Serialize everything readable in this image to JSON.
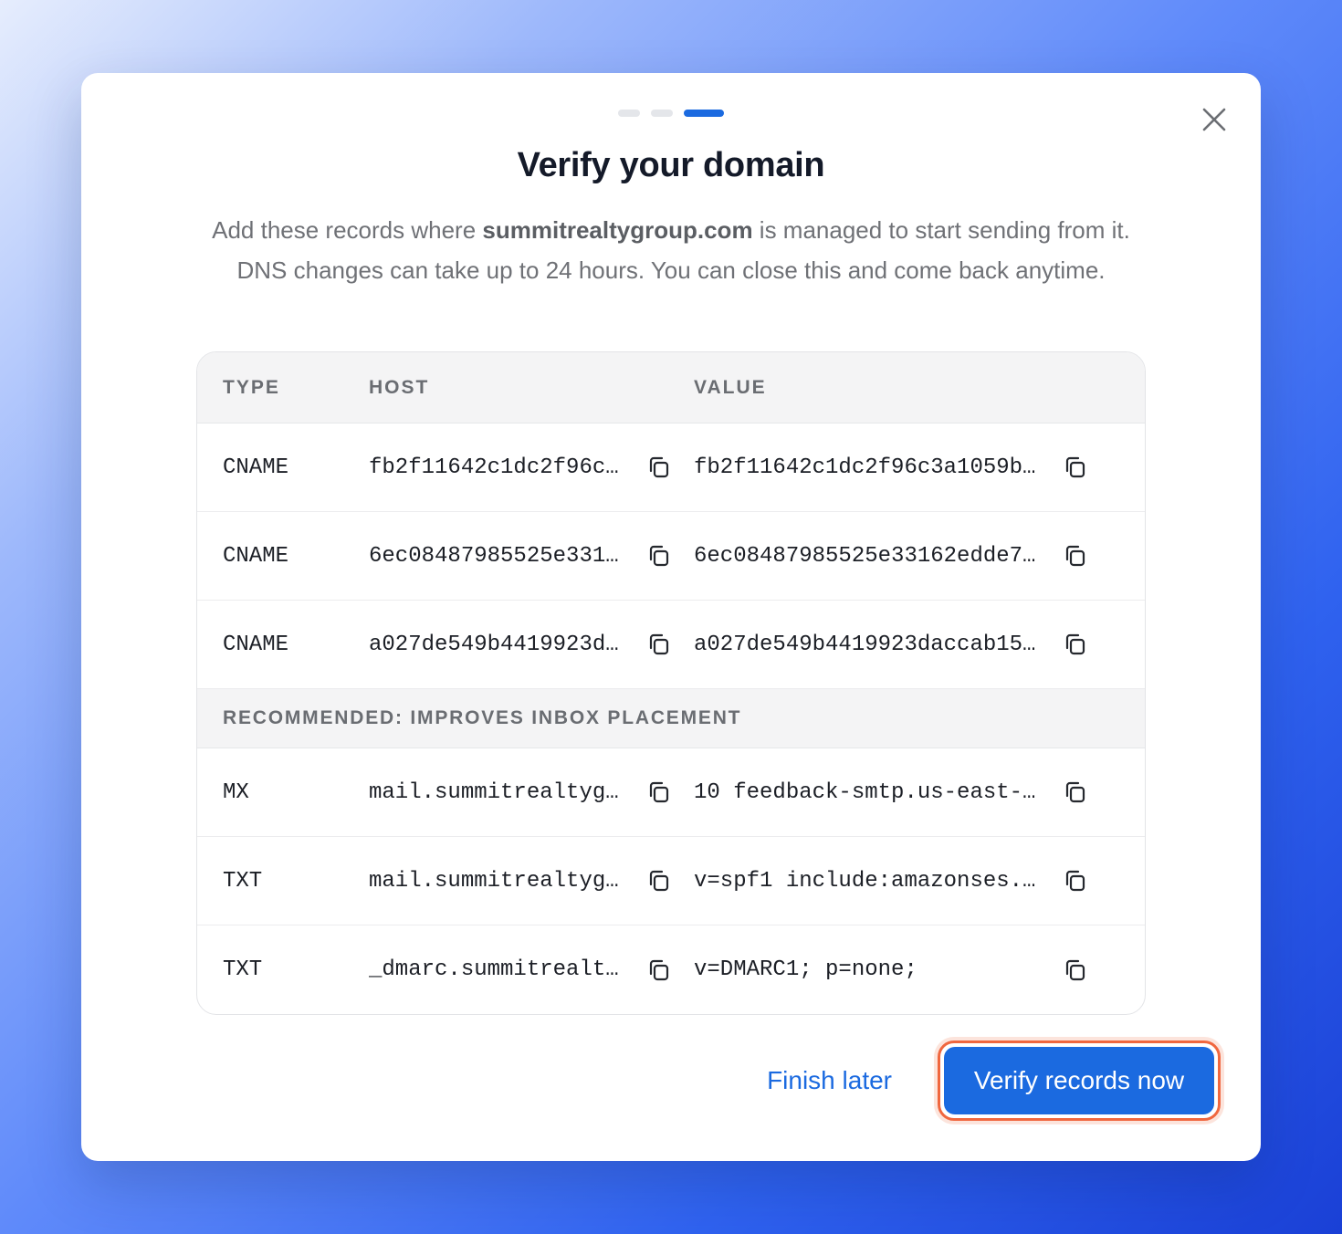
{
  "dialog": {
    "title": "Verify your domain",
    "description": {
      "before": "Add these records where ",
      "domain": "summitrealtygroup.com",
      "after": " is managed to start sending from it. DNS changes can take up to 24 hours. You can close this and come back anytime."
    },
    "progress": {
      "total_steps": 3,
      "current_step": 3
    },
    "close_icon": "close-icon"
  },
  "table": {
    "headers": {
      "type": "TYPE",
      "host": "HOST",
      "value": "VALUE"
    },
    "required_records": [
      {
        "type": "CNAME",
        "host": "fb2f11642c1dc2f96c…",
        "value": "fb2f11642c1dc2f96c3a1059b…"
      },
      {
        "type": "CNAME",
        "host": "6ec08487985525e331…",
        "value": "6ec08487985525e33162edde7…"
      },
      {
        "type": "CNAME",
        "host": "a027de549b4419923d…",
        "value": "a027de549b4419923daccab15…"
      }
    ],
    "recommended_label": "RECOMMENDED: IMPROVES INBOX PLACEMENT",
    "recommended_records": [
      {
        "type": "MX",
        "host": "mail.summitrealtyg…",
        "value": "10 feedback-smtp.us-east-…"
      },
      {
        "type": "TXT",
        "host": "mail.summitrealtyg…",
        "value": "v=spf1 include:amazonses.…"
      },
      {
        "type": "TXT",
        "host": "_dmarc.summitrealt…",
        "value": "v=DMARC1; p=none;"
      }
    ],
    "copy_icon": "copy-icon"
  },
  "actions": {
    "finish_later": "Finish later",
    "verify": "Verify records now"
  },
  "colors": {
    "accent": "#1b6ae0",
    "highlight": "#f0673f"
  }
}
